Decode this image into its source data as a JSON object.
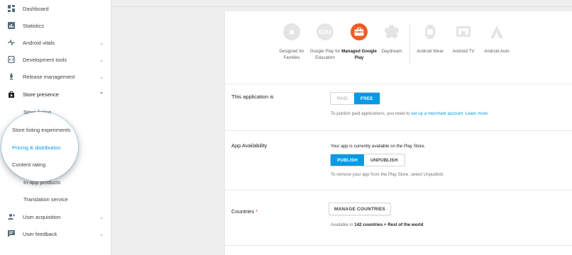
{
  "sidebar": {
    "items": [
      {
        "label": "Dashboard",
        "icon": "dashboard-icon"
      },
      {
        "label": "Statistics",
        "icon": "statistics-icon"
      },
      {
        "label": "Android vitals",
        "icon": "vitals-icon"
      },
      {
        "label": "Development tools",
        "icon": "dev-tools-icon"
      },
      {
        "label": "Release management",
        "icon": "release-icon"
      },
      {
        "label": "Store presence",
        "icon": "store-icon"
      },
      {
        "label": "User acquisition",
        "icon": "user-acquisition-icon"
      },
      {
        "label": "User feedback",
        "icon": "feedback-icon"
      }
    ],
    "sub_items": [
      {
        "label": "Store listing"
      },
      {
        "label": "Store listing experiments"
      },
      {
        "label": "Pricing & distribution"
      },
      {
        "label": "Content rating"
      },
      {
        "label": "In-app products"
      },
      {
        "label": "Translation service"
      }
    ]
  },
  "devices": [
    {
      "label": "Designed for Families",
      "glyph": "",
      "icon": "families-icon"
    },
    {
      "label": "Google Play for Education",
      "glyph": "EDU",
      "icon": "education-icon"
    },
    {
      "label": "Managed Google Play",
      "glyph": "",
      "icon": "managed-play-icon"
    },
    {
      "label": "Daydream",
      "glyph": "",
      "icon": "daydream-icon"
    },
    {
      "label": "Android Wear",
      "glyph": "",
      "icon": "wear-icon"
    },
    {
      "label": "Android TV",
      "glyph": "",
      "icon": "tv-icon"
    },
    {
      "label": "Android Auto",
      "glyph": "",
      "icon": "auto-icon"
    }
  ],
  "pricing": {
    "label": "This application is",
    "paid": "PAID",
    "free": "FREE",
    "hint_prefix": "To publish paid applications, you need to ",
    "hint_link": "set up a merchant account",
    "hint_sep": ". ",
    "learn_more": "Learn more"
  },
  "availability": {
    "label": "App Availability",
    "status": "Your app is currently available on the Play Store.",
    "publish": "PUBLISH",
    "unpublish": "UNPUBLISH",
    "hint": "To remove your app from the Play Store, select Unpublish."
  },
  "countries": {
    "label": "Countries",
    "required_mark": "*",
    "button": "MANAGE COUNTRIES",
    "available_prefix": "Available in ",
    "available_count": "142 countries + Rest of the world",
    "available_suffix": "."
  },
  "colors": {
    "accent": "#039be5",
    "managed_play": "#ef5b25"
  }
}
